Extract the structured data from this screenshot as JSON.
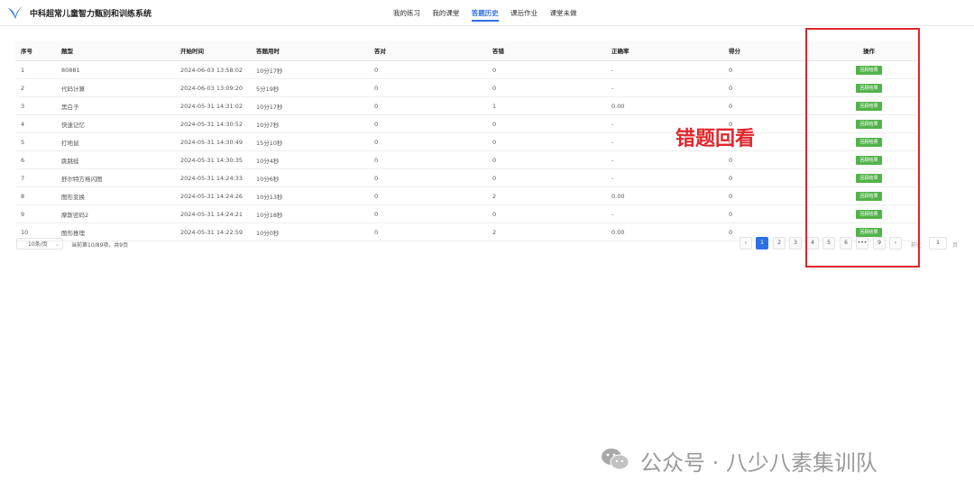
{
  "app": {
    "title": "中科超常儿童智力甄别和训练系统",
    "brand_color": "#2f6fe4"
  },
  "nav": {
    "items": [
      "我的练习",
      "我的课堂",
      "答题历史",
      "课后作业",
      "课堂未做"
    ],
    "active": "答题历史"
  },
  "table": {
    "headers": [
      "序号",
      "题型",
      "开始时间",
      "答题用时",
      "答对",
      "答错",
      "正确率",
      "得分",
      "操作"
    ],
    "rows": [
      {
        "idx": "1",
        "type": "80881",
        "start": "2024-06-03 13:58:02",
        "duration": "10分17秒",
        "right": "0",
        "wrong": "0",
        "rate": "-",
        "score": "0",
        "action": "回顾结果"
      },
      {
        "idx": "2",
        "type": "代码计算",
        "start": "2024-06-03 13:09:20",
        "duration": "5分19秒",
        "right": "0",
        "wrong": "0",
        "rate": "-",
        "score": "0",
        "action": "回顾结果"
      },
      {
        "idx": "3",
        "type": "黑白子",
        "start": "2024-05-31 14:31:02",
        "duration": "10分17秒",
        "right": "0",
        "wrong": "1",
        "rate": "0.00",
        "score": "0",
        "action": "回顾结果"
      },
      {
        "idx": "4",
        "type": "快速记忆",
        "start": "2024-05-31 14:30:52",
        "duration": "10分7秒",
        "right": "0",
        "wrong": "0",
        "rate": "-",
        "score": "0",
        "action": "回顾结果"
      },
      {
        "idx": "5",
        "type": "打地鼠",
        "start": "2024-05-31 14:30:49",
        "duration": "15分10秒",
        "right": "0",
        "wrong": "0",
        "rate": "-",
        "score": "0",
        "action": "回顾结果"
      },
      {
        "idx": "6",
        "type": "跳跳蛙",
        "start": "2024-05-31 14:30:35",
        "duration": "10分4秒",
        "right": "0",
        "wrong": "0",
        "rate": "-",
        "score": "0",
        "action": "回顾结果"
      },
      {
        "idx": "7",
        "type": "舒尔特方格闪图",
        "start": "2024-05-31 14:24:33",
        "duration": "10分6秒",
        "right": "0",
        "wrong": "0",
        "rate": "-",
        "score": "0",
        "action": "回顾结果"
      },
      {
        "idx": "8",
        "type": "图形变换",
        "start": "2024-05-31 14:24:26",
        "duration": "10分13秒",
        "right": "0",
        "wrong": "2",
        "rate": "0.00",
        "score": "0",
        "action": "回顾结果"
      },
      {
        "idx": "9",
        "type": "摩斯密码2",
        "start": "2024-05-31 14:24:21",
        "duration": "10分18秒",
        "right": "0",
        "wrong": "0",
        "rate": "-",
        "score": "0",
        "action": "回顾结果"
      },
      {
        "idx": "10",
        "type": "图形推理",
        "start": "2024-05-31 14:22:59",
        "duration": "10分0秒",
        "right": "0",
        "wrong": "2",
        "rate": "0.00",
        "score": "0",
        "action": "回顾结果"
      }
    ],
    "action_color": "#52b34a"
  },
  "pagination": {
    "page_size": "10条/页",
    "info": "当前第10/89项，共9页",
    "prev": "‹",
    "pages": [
      "1",
      "2",
      "3",
      "4",
      "5",
      "6",
      "•••",
      "9"
    ],
    "current": "1",
    "next": "›",
    "jump_label": "前往",
    "jump_value": "1",
    "jump_suffix": "页"
  },
  "annotation": {
    "text": "错题回看",
    "color": "#e0262b"
  },
  "watermark": {
    "text": "公众号 · 八少八素集训队"
  }
}
